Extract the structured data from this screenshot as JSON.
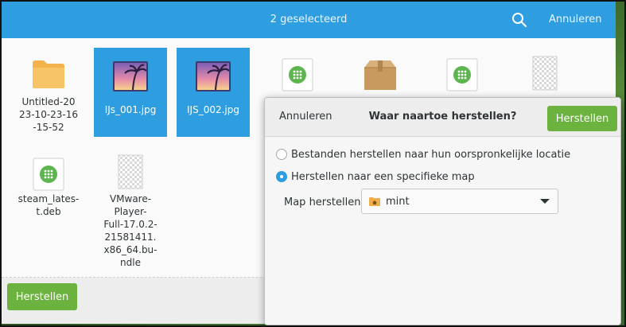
{
  "header": {
    "title": "2 geselecteerd",
    "cancel_label": "Annuleren",
    "search_icon": "search-icon"
  },
  "files": [
    {
      "label": "Untitled-20 23-10-23-16 -15-52",
      "lines": [
        "Untitled-20",
        "23-10-23-16",
        "-15-52"
      ],
      "icon": "folder-icon",
      "selected": false
    },
    {
      "label": "IJs_001.jpg",
      "lines": [
        "IJs_001.jpg"
      ],
      "icon": "image-icon",
      "selected": true
    },
    {
      "label": "IJS_002.jpg",
      "lines": [
        "IJS_002.jpg"
      ],
      "icon": "image-icon",
      "selected": true
    },
    {
      "label": "",
      "lines": [],
      "icon": "package-deb-icon",
      "selected": false
    },
    {
      "label": "",
      "lines": [],
      "icon": "archive-box-icon",
      "selected": false
    },
    {
      "label": "",
      "lines": [],
      "icon": "package-deb-icon",
      "selected": false
    },
    {
      "label": "",
      "lines": [],
      "icon": "generic-file-icon",
      "selected": false
    },
    {
      "label": "steam_lates- t.deb",
      "lines": [
        "steam_lates-",
        "t.deb"
      ],
      "icon": "package-deb-icon",
      "selected": false
    },
    {
      "label": "VMware-Player-Full-17.0.2-21581411.x86_64.bundle",
      "lines": [
        "VMware-",
        "Player-",
        "Full-17.0.2-",
        "21581411.",
        "x86_64.bu-",
        "ndle"
      ],
      "icon": "generic-file-icon",
      "selected": false
    }
  ],
  "bottom_bar": {
    "restore_label": "Herstellen"
  },
  "dialog": {
    "cancel_label": "Annuleren",
    "title": "Waar naartoe herstellen?",
    "restore_label": "Herstellen",
    "option_original": "Bestanden herstellen naar hun oorspronkelijke locatie",
    "option_specific": "Herstellen naar een specifieke map",
    "selected_option": "specific",
    "folder_label": "Map herstellen",
    "folder_value": "mint",
    "folder_icon": "home-folder-icon"
  },
  "colors": {
    "accent": "#2f9ee1",
    "action_green": "#6cb23f"
  }
}
